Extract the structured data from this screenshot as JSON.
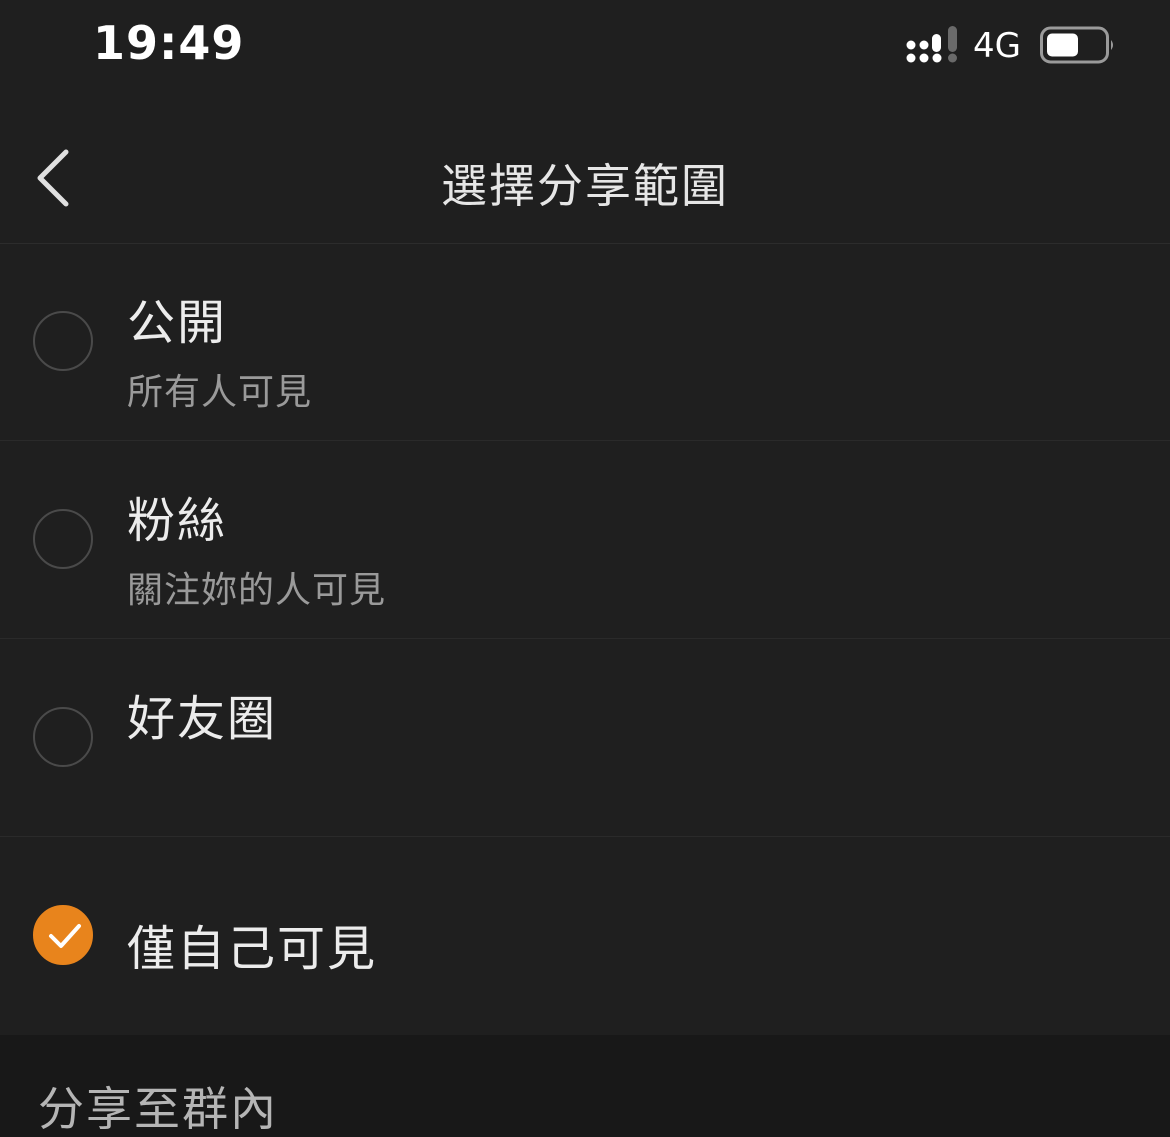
{
  "status_bar": {
    "time": "19:49",
    "network": "4G",
    "signal_icon": "cellular-signal-icon",
    "battery_icon": "battery-icon",
    "battery_level": 0.5
  },
  "nav": {
    "back_icon": "chevron-left-icon",
    "title": "選擇分享範圍"
  },
  "options": [
    {
      "title": "公開",
      "subtitle": "所有人可見",
      "selected": false
    },
    {
      "title": "粉絲",
      "subtitle": "關注妳的人可見",
      "selected": false
    },
    {
      "title": "好友圈",
      "subtitle": "",
      "selected": false
    },
    {
      "title": "僅自己可見",
      "subtitle": "",
      "selected": true
    }
  ],
  "section": {
    "label": "分享至群內"
  },
  "colors": {
    "accent": "#e8841c",
    "background": "#1f1f1f",
    "footer_background": "#181818"
  }
}
